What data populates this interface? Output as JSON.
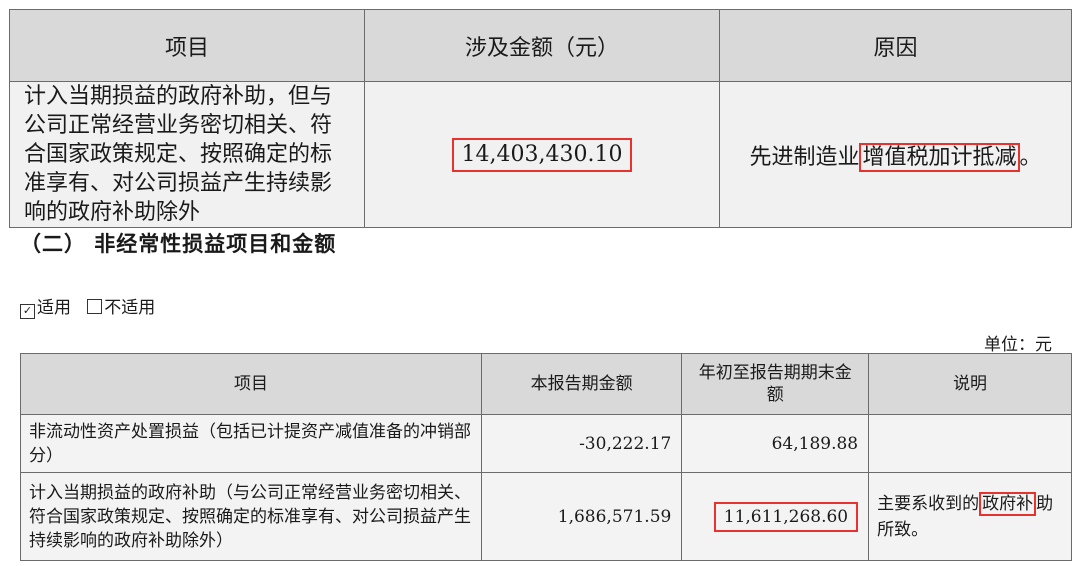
{
  "table1": {
    "headers": [
      "项目",
      "涉及金额（元）",
      "原因"
    ],
    "row": {
      "item": "计入当期损益的政府补助，但与公司正常经营业务密切相关、符合国家政策规定、按照确定的标准享有、对公司损益产生持续影响的政府补助除外",
      "amount": "14,403,430.10",
      "reason_pre": "先进制造业",
      "reason_highlight": "增值税加计抵减",
      "reason_post": "。"
    }
  },
  "section2_title": "（二） 非经常性损益项目和金额",
  "options": {
    "checked_label": "适用",
    "unchecked_label": "不适用",
    "checked_mark": "☑",
    "unchecked_mark": "□"
  },
  "unit_label": "单位：元",
  "table2": {
    "headers": [
      "项目",
      "本报告期金额",
      "年初至报告期期末金额",
      "说明"
    ],
    "rows": [
      {
        "item": "非流动性资产处置损益（包括已计提资产减值准备的冲销部分）",
        "current": "-30,222.17",
        "ytd": "64,189.88",
        "note": ""
      },
      {
        "item": "计入当期损益的政府补助（与公司正常经营业务密切相关、符合国家政策规定、按照确定的标准享有、对公司损益产生持续影响的政府补助除外）",
        "current": "1,686,571.59",
        "ytd": "11,611,268.60",
        "note_pre": "主要系收到的",
        "note_highlight": "政府补",
        "note_post": "助所致。"
      }
    ]
  },
  "highlight_color": "#e8322f",
  "header_bg": "#d9d9d9"
}
